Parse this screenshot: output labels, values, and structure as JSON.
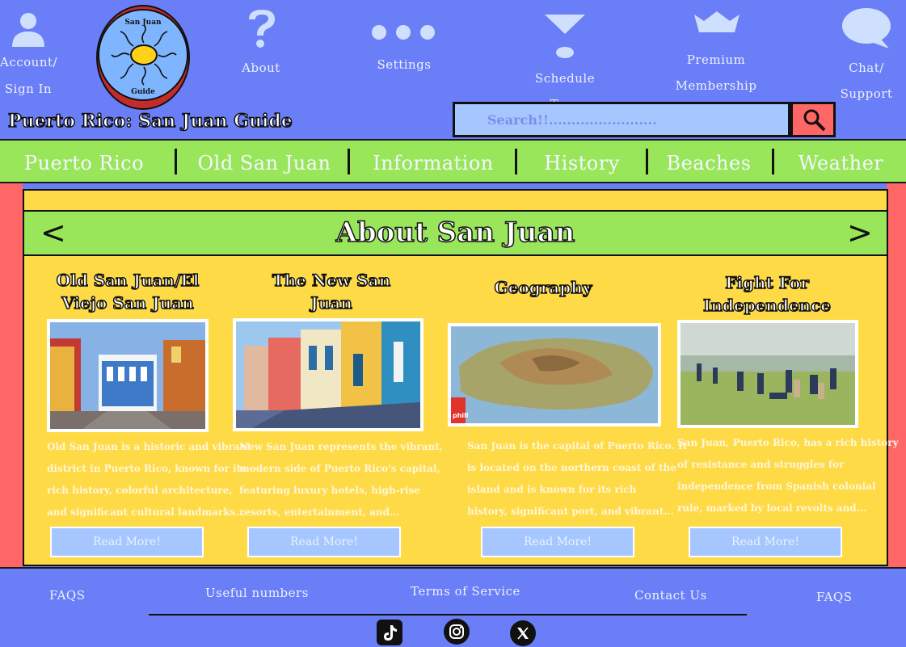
{
  "header": {
    "account_label_1": "Account/",
    "account_label_2": "Sign In",
    "logo_top": "San Juan",
    "logo_bottom": "Guide",
    "about_label": "About",
    "settings_label": "Settings",
    "tour_label": "Schedule Tour",
    "premium_label_1": "Premium",
    "premium_label_2": "Membership",
    "chat_label_1": "Chat/",
    "chat_label_2": "Support",
    "site_title": "Puerto Rico: San Juan Guide",
    "search_placeholder": "Search!!........................"
  },
  "menu": [
    {
      "label": "Puerto Rico"
    },
    {
      "label": "Old San Juan"
    },
    {
      "label": "Information"
    },
    {
      "label": "History"
    },
    {
      "label": "Beaches"
    },
    {
      "label": "Weather"
    }
  ],
  "main": {
    "banner_title": "About San Juan",
    "prev_arrow": "<",
    "next_arrow": ">",
    "cards": [
      {
        "title_1": "Old San Juan/El",
        "title_2": "Viejo San Juan",
        "lines": [
          "Old San Juan is a historic and vibrant",
          "district in Puerto Rico, known for its",
          "rich history, colorful architecture,",
          "and significant cultural landmarks..."
        ],
        "button": "Read More!"
      },
      {
        "title_1": "The New San",
        "title_2": "Juan",
        "lines": [
          "New San Juan represents the vibrant,",
          "modern side of Puerto Rico's capital,",
          "featuring luxury hotels, high-rise",
          "resorts, entertainment, and..."
        ],
        "button": "Read More!"
      },
      {
        "title_1": "Geography",
        "title_2": "",
        "lines": [
          "San Juan is the capital of Puerto Rico. It",
          "is located on the northern coast of the",
          "island and is known for its rich",
          "history, significant port, and vibrant..."
        ],
        "button": "Read More!",
        "map_badge": "phill"
      },
      {
        "title_1": "Fight For",
        "title_2": "Independence",
        "lines": [
          "San Juan, Puerto Rico, has a rich history",
          "of resistance and struggles for",
          "independence from Spanish colonial",
          "rule, marked by local revolts and..."
        ],
        "button": "Read More!"
      }
    ]
  },
  "footer": {
    "faqs_left": "FAQS",
    "useful_numbers": "Useful numbers",
    "terms": "Terms of Service",
    "contact": "Contact Us",
    "faqs_right": "FAQS"
  },
  "colors": {
    "background": "#6a7ff7",
    "menu_green": "#99e65a",
    "main_yellow": "#ffda47",
    "side_red": "#ff6666",
    "button_blue": "#a6c6ff"
  },
  "icons": [
    "user-icon",
    "question-icon",
    "dots-icon",
    "funnel-icon",
    "crown-icon",
    "chat-bubble-icon",
    "search-icon",
    "tiktok-icon",
    "instagram-icon",
    "x-icon"
  ]
}
